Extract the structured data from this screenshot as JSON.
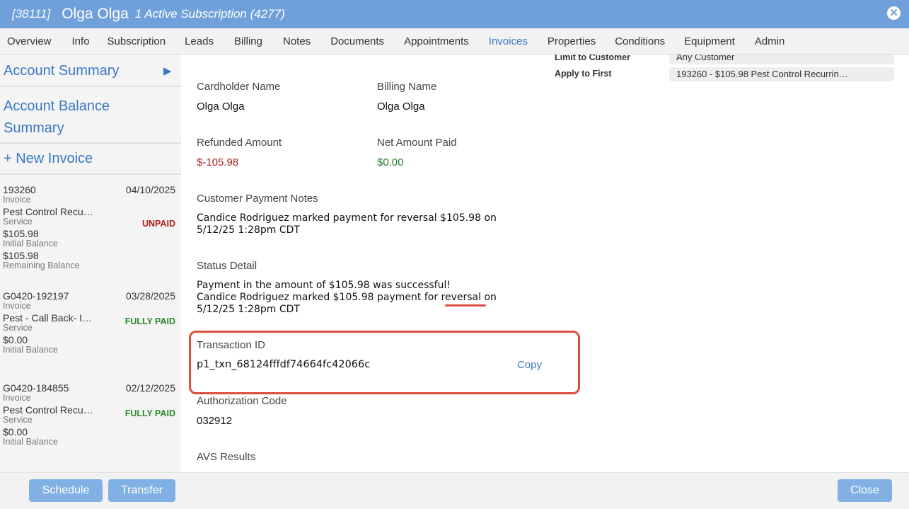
{
  "header": {
    "id": "[38111]",
    "name": "Olga Olga",
    "subscription": "1 Active Subscription (4277)"
  },
  "tabs": [
    "Overview",
    "Info",
    "Subscription",
    "Leads",
    "Billing",
    "Notes",
    "Documents",
    "Appointments",
    "Invoices",
    "Properties",
    "Conditions",
    "Equipment",
    "Admin"
  ],
  "active_tab": "Invoices",
  "sidebar": {
    "account_summary": "Account Summary",
    "account_balance_line1": "Account Balance",
    "account_balance_line2": "Summary",
    "new_invoice": "+ New Invoice",
    "invoices": [
      {
        "number": "193260",
        "date": "04/10/2025",
        "type": "Invoice",
        "service": "Pest Control Recu…",
        "service_label": "Service",
        "status": "UNPAID",
        "initial": "$105.98",
        "initial_label": "Initial Balance",
        "remaining": "$105.98",
        "remaining_label": "Remaining Balance"
      },
      {
        "number": "G0420-192197",
        "date": "03/28/2025",
        "type": "Invoice",
        "service": "Pest - Call Back- I…",
        "service_label": "Service",
        "status": "FULLY PAID",
        "initial": "$0.00",
        "initial_label": "Initial Balance"
      },
      {
        "number": "G0420-184855",
        "date": "02/12/2025",
        "type": "Invoice",
        "service": "Pest Control Recu…",
        "service_label": "Service",
        "status": "FULLY PAID",
        "initial": "$0.00",
        "initial_label": "Initial Balance"
      }
    ]
  },
  "details": {
    "cardholder_label": "Cardholder Name",
    "cardholder": "Olga Olga",
    "billing_label": "Billing Name",
    "billing": "Olga Olga",
    "refunded_label": "Refunded Amount",
    "refunded": "$-105.98",
    "net_label": "Net Amount Paid",
    "net": "$0.00",
    "notes_label": "Customer Payment Notes",
    "notes_line1": "Candice Rodriguez marked payment for reversal $105.98 on",
    "notes_line2": "5/12/25 1:28pm CDT",
    "status_label": "Status Detail",
    "status_line1": "Payment in the amount of $105.98 was successful!",
    "status_line2": "Candice Rodriguez marked $105.98 payment for reversal on",
    "status_line3": "5/12/25 1:28pm CDT",
    "txn_label": "Transaction ID",
    "txn": "p1_txn_68124fffdf74664fc42066c",
    "copy": "Copy",
    "auth_label": "Authorization Code",
    "auth": "032912",
    "avs_label": "AVS Results"
  },
  "right_panel": {
    "limit_label": "Limit to Customer",
    "limit_value": "Any Customer",
    "apply_label": "Apply to First",
    "apply_value": "193260 - $105.98 Pest Control Recurrin…"
  },
  "footer": {
    "schedule": "Schedule",
    "transfer": "Transfer",
    "close": "Close"
  },
  "colors": {
    "header": "#6fa0da",
    "link": "#3a78c2",
    "unpaid": "#b21d1d",
    "paid": "#2a8a2a",
    "highlight": "#d9503f",
    "button": "#80b0e4"
  }
}
